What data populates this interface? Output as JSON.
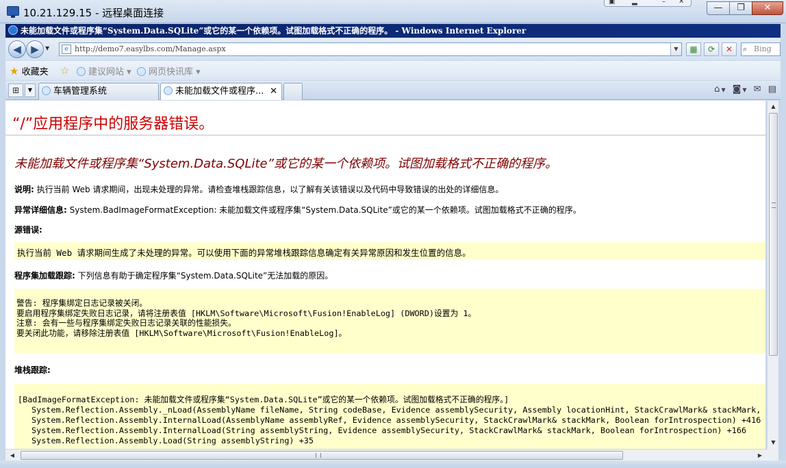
{
  "rdp": {
    "title": "10.21.129.15 - 远程桌面连接",
    "minimize_glyph": "—",
    "restore_glyph": "❐",
    "close_glyph": "✕"
  },
  "ie": {
    "window_title": "未能加载文件或程序集“System.Data.SQLite”或它的某一个依赖项。试图加载格式不正确的程序。 - Windows Internet Explorer",
    "url": "http://demo7.easylbs.com/Manage.aspx",
    "search_placeholder": "Bing",
    "favorites_label": "收藏夹",
    "fav_items": [
      "建议网站 ▾",
      "网页快讯库 ▾"
    ],
    "tabs": [
      {
        "label": "车辆管理系统"
      },
      {
        "label": "未能加载文件或程序..."
      }
    ],
    "close_tab_glyph": "✕"
  },
  "page": {
    "heading": "“/”应用程序中的服务器错误。",
    "error_title": "未能加载文件或程序集“System.Data.SQLite”或它的某一个依赖项。试图加载格式不正确的程序。",
    "description_label": "说明:",
    "description": " 执行当前 Web 请求期间，出现未处理的异常。请检查堆栈跟踪信息，以了解有关该错误以及代码中导致错误的出处的详细信息。",
    "exception_label": "异常详细信息:",
    "exception": " System.BadImageFormatException: 未能加载文件或程序集“System.Data.SQLite”或它的某一个依赖项。试图加载格式不正确的程序。",
    "source_error_label": "源错误:",
    "source_error_text": "执行当前 Web 请求期间生成了未处理的异常。可以使用下面的异常堆栈跟踪信息确定有关异常原因和发生位置的信息。",
    "assembly_trace_label": "程序集加载跟踪:",
    "assembly_trace": " 下列信息有助于确定程序集“System.Data.SQLite”无法加载的原因。",
    "assembly_box_lines": [
      "警告: 程序集绑定日志记录被关闭。",
      "要启用程序集绑定失败日志记录，请将注册表值 [HKLM\\Software\\Microsoft\\Fusion!EnableLog] (DWORD)设置为 1。",
      "注意: 会有一些与程序集绑定失败日志记录关联的性能损失。",
      "要关闭此功能，请移除注册表值 [HKLM\\Software\\Microsoft\\Fusion!EnableLog]。"
    ],
    "stack_trace_label": "堆栈跟踪:",
    "stack_lines": [
      "[BadImageFormatException: 未能加载文件或程序集“System.Data.SQLite”或它的某一个依赖项。试图加载格式不正确的程序。]",
      "System.Reflection.Assembly._nLoad(AssemblyName fileName, String codeBase, Evidence assemblySecurity, Assembly locationHint, StackCrawlMark& stackMark, Boo",
      "System.Reflection.Assembly.InternalLoad(AssemblyName assemblyRef, Evidence assemblySecurity, StackCrawlMark& stackMark, Boolean forIntrospection) +416",
      "System.Reflection.Assembly.InternalLoad(String assemblyString, Evidence assemblySecurity, StackCrawlMark& stackMark, Boolean forIntrospection) +166",
      "System.Reflection.Assembly.Load(String assemblyString) +35"
    ]
  }
}
